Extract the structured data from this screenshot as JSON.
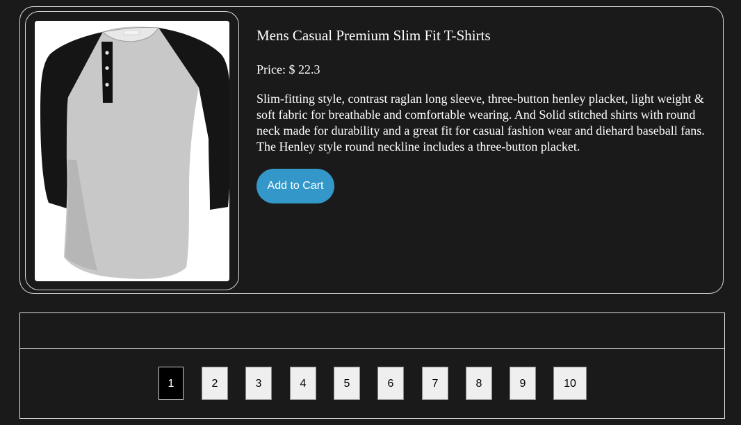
{
  "product": {
    "title": "Mens Casual Premium Slim Fit T-Shirts",
    "price_label": "Price: $",
    "price": "22.3",
    "description": "Slim-fitting style, contrast raglan long sleeve, three-button henley placket, light weight & soft fabric for breathable and comfortable wearing. And Solid stitched shirts with round neck made for durability and a great fit for casual fashion wear and diehard baseball fans. The Henley style round neckline includes a three-button placket.",
    "add_to_cart_label": "Add to Cart",
    "image_icon": "raglan-henley-tshirt-image"
  },
  "pagination": {
    "pages": [
      "1",
      "2",
      "3",
      "4",
      "5",
      "6",
      "7",
      "8",
      "9",
      "10"
    ],
    "current": "1"
  },
  "colors": {
    "background": "#1a1a1a",
    "accent": "#3398c9",
    "border": "#d9d9d9",
    "active_page_bg": "#000000",
    "page_bg": "#efefef"
  }
}
